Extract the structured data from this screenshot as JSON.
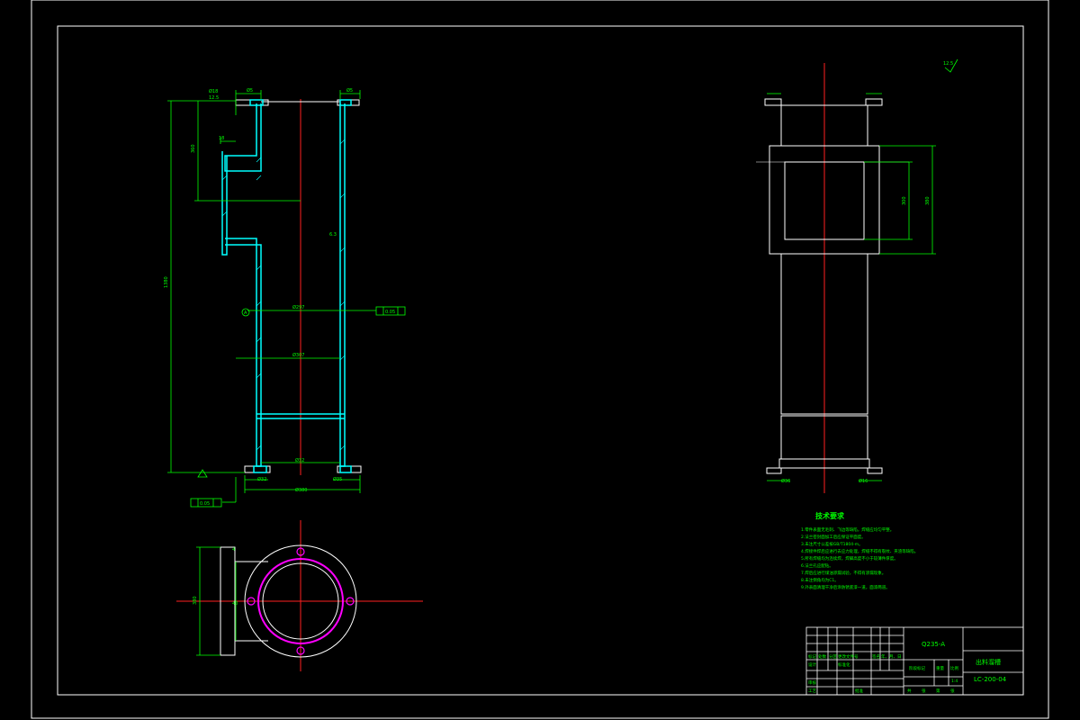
{
  "drawing": {
    "colors": {
      "background": "#000000",
      "frame": "#ffffff",
      "outline": "#ffffff",
      "centerline": "#ff2020",
      "dimension": "#00ff00",
      "hatch": "#00ffff",
      "accent": "#ff00ff",
      "text": "#00ff00"
    },
    "front_view": {
      "dimensions": {
        "top_left_flange": "Ø18",
        "top_left_bolt": "Ø5",
        "top_right_bolt": "Ø5",
        "overall_height": "1380",
        "outlet_height": "360",
        "outlet_offset": "18",
        "inner_diameter_upper": "Ø297",
        "inner_diameter_lower": "Ø307",
        "bottom_flange_inner": "Ø32",
        "bottom_flange_outer": "Ø380",
        "bottom_bolt_left": "Ø32",
        "bottom_bolt_right": "Ø35"
      },
      "surface_finish": "12.5",
      "datum_label": "A",
      "tolerance_left": "0.05",
      "tolerance_right": "0.05",
      "roughness_mark": "6.3"
    },
    "side_view": {
      "dimensions": {
        "outlet_inner": "300",
        "outlet_outer": "380",
        "bottom_left": "Ø36",
        "bottom_right": "Ø16"
      },
      "surface_finish": "12.5"
    },
    "bottom_view": {
      "dimensions": {
        "width": "380",
        "offset": "40",
        "bolt": "4"
      }
    },
    "notes": {
      "title": "技术要求",
      "items": [
        "1.零件表面无毛刺、飞边等缺陷，焊缝应均匀平整。",
        "2.法兰密封面加工后应保证平面度。",
        "3.未注尺寸公差按GB/T1804-m。",
        "4.焊接件焊后应进行去应力处理，焊缝不得有裂纹、夹渣等缺陷。",
        "5.所有焊缝均为连续焊，焊脚高度不小于较薄件厚度。",
        "6.法兰孔应配钻。",
        "7.焊后应进行煤油渗漏试验，不得有渗漏现象。",
        "8.未注倒角均为C1。",
        "9.外表面清理干净后涂防锈底漆一道，面漆两道。"
      ]
    },
    "title_block": {
      "material": "Q235-A",
      "part_name": "出料溜槽",
      "drawing_number": "LC-200-04",
      "scale": "1:4",
      "stage_label": "阶段标记",
      "weight_label": "重量",
      "scale_label": "比例",
      "sheet_labels": [
        "共",
        "张",
        "第",
        "张"
      ],
      "row_labels": [
        "标记",
        "处数",
        "分区",
        "更改文件号",
        "签名",
        "年、月、日"
      ],
      "design_label": "设计",
      "standard_label": "标准化",
      "review_label": "审核",
      "process_label": "工艺",
      "approve_label": "批准"
    }
  }
}
